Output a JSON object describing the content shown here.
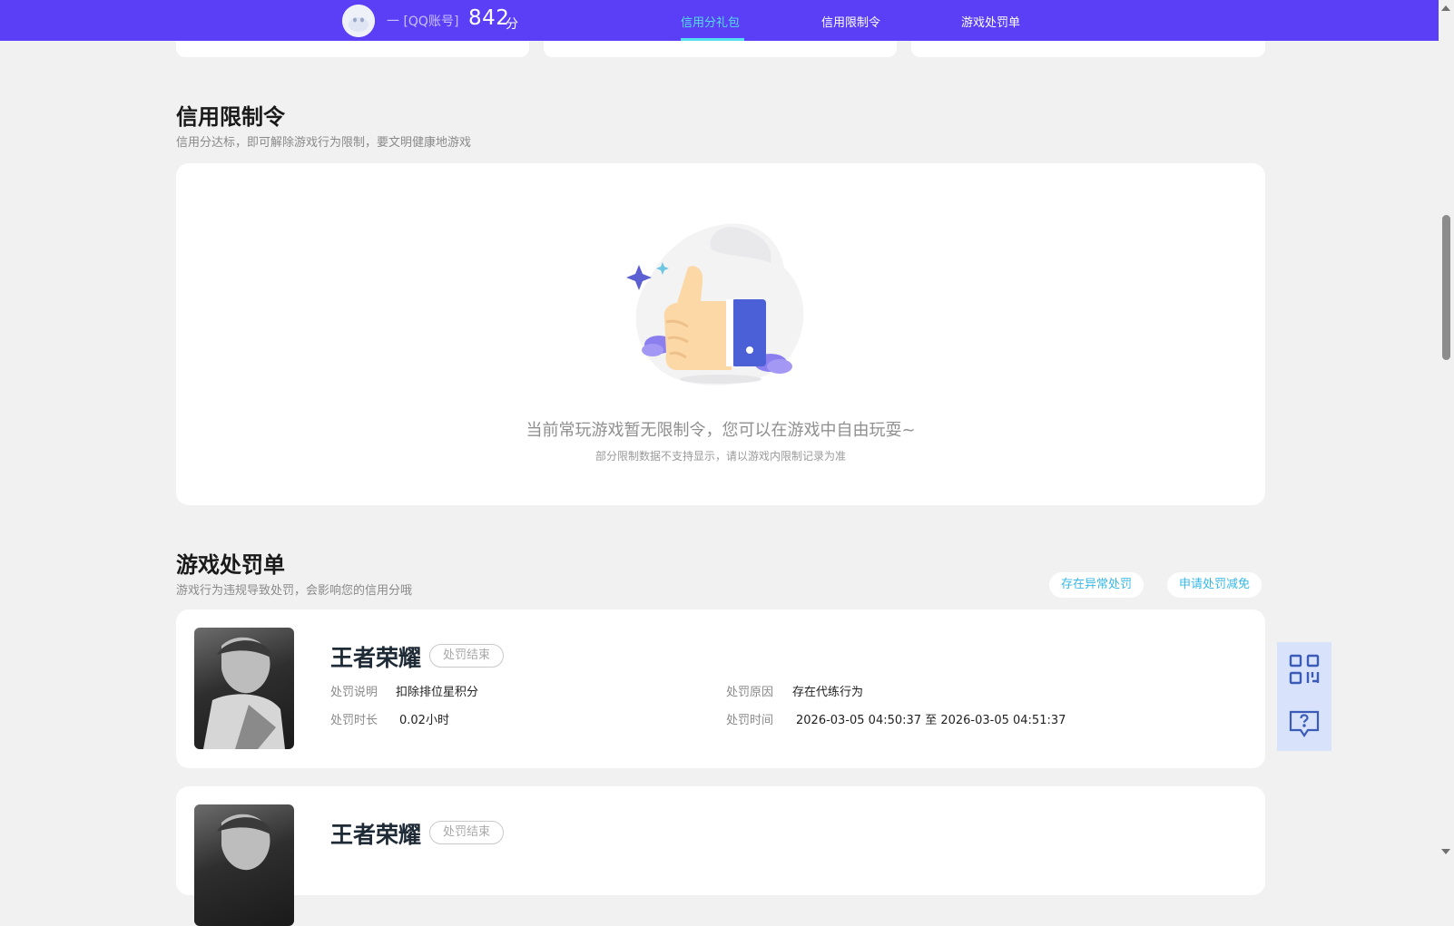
{
  "header": {
    "account_label": "一 [QQ账号]",
    "score": "842",
    "score_unit": "分",
    "tabs": [
      {
        "label": "信用分礼包",
        "active": true
      },
      {
        "label": "信用限制令",
        "active": false
      },
      {
        "label": "游戏处罚单",
        "active": false
      }
    ]
  },
  "restriction": {
    "title": "信用限制令",
    "subtitle": "信用分达标，即可解除游戏行为限制，要文明健康地游戏",
    "empty_text": "当前常玩游戏暂无限制令，您可以在游戏中自由玩耍~",
    "empty_subtext": "部分限制数据不支持显示，请以游戏内限制记录为准"
  },
  "penalty": {
    "title": "游戏处罚单",
    "subtitle": "游戏行为违规导致处罚，会影响您的信用分哦",
    "buttons": {
      "abnormal": "存在异常处罚",
      "reduce": "申请处罚减免"
    },
    "labels": {
      "desc": "处罚说明",
      "reason": "处罚原因",
      "duration": "处罚时长",
      "time": "处罚时间"
    },
    "items": [
      {
        "game": "王者荣耀",
        "status": "处罚结束",
        "desc": "扣除排位星积分",
        "reason": "存在代练行为",
        "duration": "0.02小时",
        "time": "2026-03-05 04:50:37 至 2026-03-05 04:51:37"
      },
      {
        "game": "王者荣耀",
        "status": "处罚结束"
      }
    ]
  },
  "colors": {
    "header_bg": "#5a3ff6",
    "accent": "#53dff0",
    "link": "#37b9e8",
    "page_bg": "#f1f1f1"
  },
  "icons": {
    "float_top": "qr-code-icon",
    "float_bottom": "help-chat-icon"
  }
}
